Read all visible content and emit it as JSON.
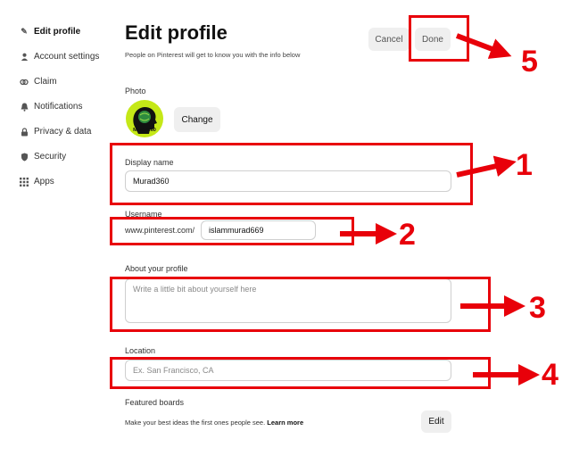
{
  "sidebar": {
    "items": [
      {
        "label": "Edit profile",
        "icon": "pencil-icon"
      },
      {
        "label": "Account settings",
        "icon": "person-icon"
      },
      {
        "label": "Claim",
        "icon": "link-icon"
      },
      {
        "label": "Notifications",
        "icon": "bell-icon"
      },
      {
        "label": "Privacy & data",
        "icon": "lock-icon"
      },
      {
        "label": "Security",
        "icon": "shield-icon"
      },
      {
        "label": "Apps",
        "icon": "grid-icon"
      }
    ]
  },
  "header": {
    "title": "Edit profile",
    "subtitle": "People on Pinterest will get to know you with the info below",
    "cancel_label": "Cancel",
    "done_label": "Done"
  },
  "photo": {
    "label": "Photo",
    "avatar_text": "Murad360",
    "change_label": "Change"
  },
  "form": {
    "display_name_label": "Display name",
    "display_name_value": "Murad360",
    "username_label": "Username",
    "username_prefix": "www.pinterest.com/",
    "username_value": "islammurad669",
    "about_label": "About your profile",
    "about_placeholder": "Write a little bit about yourself here",
    "location_label": "Location",
    "location_placeholder": "Ex. San Francisco, CA"
  },
  "featured": {
    "label": "Featured boards",
    "description": "Make your best ideas the first ones people see.",
    "learn_more": "Learn more",
    "edit_label": "Edit"
  },
  "annotations": {
    "numbers": [
      "1",
      "2",
      "3",
      "4",
      "5"
    ],
    "color": "#e8000a"
  }
}
